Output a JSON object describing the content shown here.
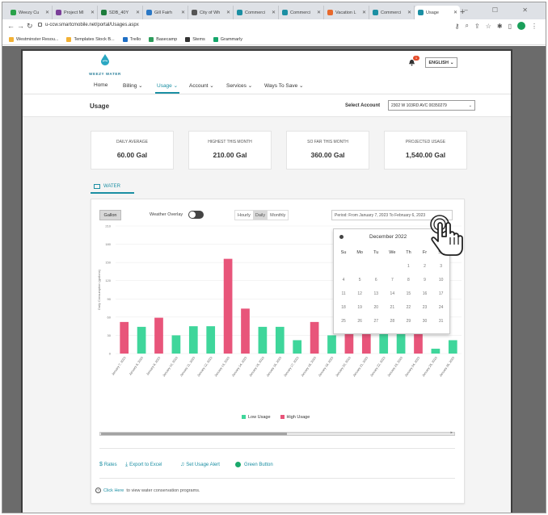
{
  "browser": {
    "tabs": [
      {
        "label": "Weezy Cu",
        "color": "#2aa24a",
        "active": false
      },
      {
        "label": "Project Ml",
        "color": "#7b3f99",
        "active": false
      },
      {
        "label": "SDB_40Y",
        "color": "#1e7d3c",
        "active": false
      },
      {
        "label": "Gill Fairh",
        "color": "#2b78c5",
        "active": false
      },
      {
        "label": "City of Wh",
        "color": "#555555",
        "active": false
      },
      {
        "label": "Commerci",
        "color": "#1b8fa3",
        "active": false
      },
      {
        "label": "Commerci",
        "color": "#1b8fa3",
        "active": false
      },
      {
        "label": "Vacation L",
        "color": "#e8692c",
        "active": false
      },
      {
        "label": "Commerci",
        "color": "#1b8fa3",
        "active": false
      },
      {
        "label": "Usage",
        "color": "#1b8fa3",
        "active": true
      }
    ],
    "url": "u-ccw.smartcmobile.net/portal/Usages.aspx",
    "bookmarks": [
      {
        "label": "Westminster Resou...",
        "color": "#f2b134"
      },
      {
        "label": "Templates Stock B...",
        "color": "#f2b134"
      },
      {
        "label": "Trello",
        "color": "#1f6fc5"
      },
      {
        "label": "Basecamp",
        "color": "#2d9d5c"
      },
      {
        "label": "Stems",
        "color": "#333333"
      },
      {
        "label": "Grammarly",
        "color": "#15a66b"
      }
    ]
  },
  "header": {
    "logo_text": "WEEZY WATER",
    "notification_count": "1",
    "language": "ENGLISH"
  },
  "nav": [
    {
      "label": "Home",
      "active": false,
      "caret": false
    },
    {
      "label": "Billing",
      "active": false,
      "caret": true
    },
    {
      "label": "Usage",
      "active": true,
      "caret": true
    },
    {
      "label": "Account",
      "active": false,
      "caret": true
    },
    {
      "label": "Services",
      "active": false,
      "caret": true
    },
    {
      "label": "Ways To Save",
      "active": false,
      "caret": true
    }
  ],
  "page": {
    "title": "Usage",
    "select_account_label": "Select Account",
    "account_value": "2302 W 103RD AVC 00350279"
  },
  "kpis": [
    {
      "label": "DAILY AVERAGE",
      "value": "60.00 Gal"
    },
    {
      "label": "HIGHEST THIS MONTH",
      "value": "210.00 Gal"
    },
    {
      "label": "SO FAR THIS MONTH",
      "value": "360.00 Gal"
    },
    {
      "label": "PROJECTED USAGE",
      "value": "1,540.00 Gal"
    }
  ],
  "water_tab": "WATER",
  "controls": {
    "unit": "Gallon",
    "weather_overlay": "Weather Overlay",
    "periods": [
      "Hourly",
      "Daily",
      "Monthly"
    ],
    "selected_period": "Daily",
    "period_range": "Period: From January 7, 2023 To February 6, 2023"
  },
  "chart_data": {
    "type": "bar",
    "ylabel": "Daily Consumption (gallons)",
    "ylim": [
      0,
      210
    ],
    "yticks": [
      0,
      30,
      60,
      90,
      120,
      150,
      180,
      210
    ],
    "categories": [
      "January 7, 2023",
      "January 8, 2023",
      "January 9, 2023",
      "January 10, 2023",
      "January 11, 2023",
      "January 12, 2023",
      "January 13, 2023",
      "January 14, 2023",
      "January 15, 2023",
      "January 16, 2023",
      "January 17, 2023",
      "January 18, 2023",
      "January 19, 2023",
      "January 20, 2023",
      "January 21, 2023",
      "January 22, 2023",
      "January 23, 2023",
      "January 24, 2023",
      "January 25, 2023",
      "January 26, 2023"
    ],
    "values": [
      52,
      44,
      59,
      30,
      45,
      45,
      156,
      74,
      44,
      44,
      22,
      52,
      30,
      76,
      52,
      38,
      38,
      106,
      8,
      22
    ],
    "series_membership": [
      "High",
      "Low",
      "High",
      "Low",
      "Low",
      "Low",
      "High",
      "High",
      "Low",
      "Low",
      "Low",
      "High",
      "Low",
      "High",
      "High",
      "Low",
      "Low",
      "High",
      "Low",
      "Low"
    ],
    "legend": [
      {
        "name": "Low Usage",
        "color": "#3fd69b"
      },
      {
        "name": "High Usage",
        "color": "#e8557a"
      }
    ]
  },
  "actions": {
    "rates": "Rates",
    "export": "Export to Excel",
    "alert": "Set Usage Alert",
    "green": "Green Button"
  },
  "help": {
    "link": "Click Here",
    "text": "to view water conservation programs."
  },
  "calendar": {
    "title": "December 2022",
    "dow": [
      "Su",
      "Mo",
      "Tu",
      "We",
      "Th",
      "Fr",
      "Sa"
    ],
    "weeks": [
      [
        "",
        "",
        "",
        "",
        "1",
        "2",
        "3"
      ],
      [
        "4",
        "5",
        "6",
        "7",
        "8",
        "9",
        "10"
      ],
      [
        "11",
        "12",
        "13",
        "14",
        "15",
        "16",
        "17"
      ],
      [
        "18",
        "19",
        "20",
        "21",
        "22",
        "23",
        "24"
      ],
      [
        "25",
        "26",
        "27",
        "28",
        "29",
        "30",
        "31"
      ]
    ]
  }
}
